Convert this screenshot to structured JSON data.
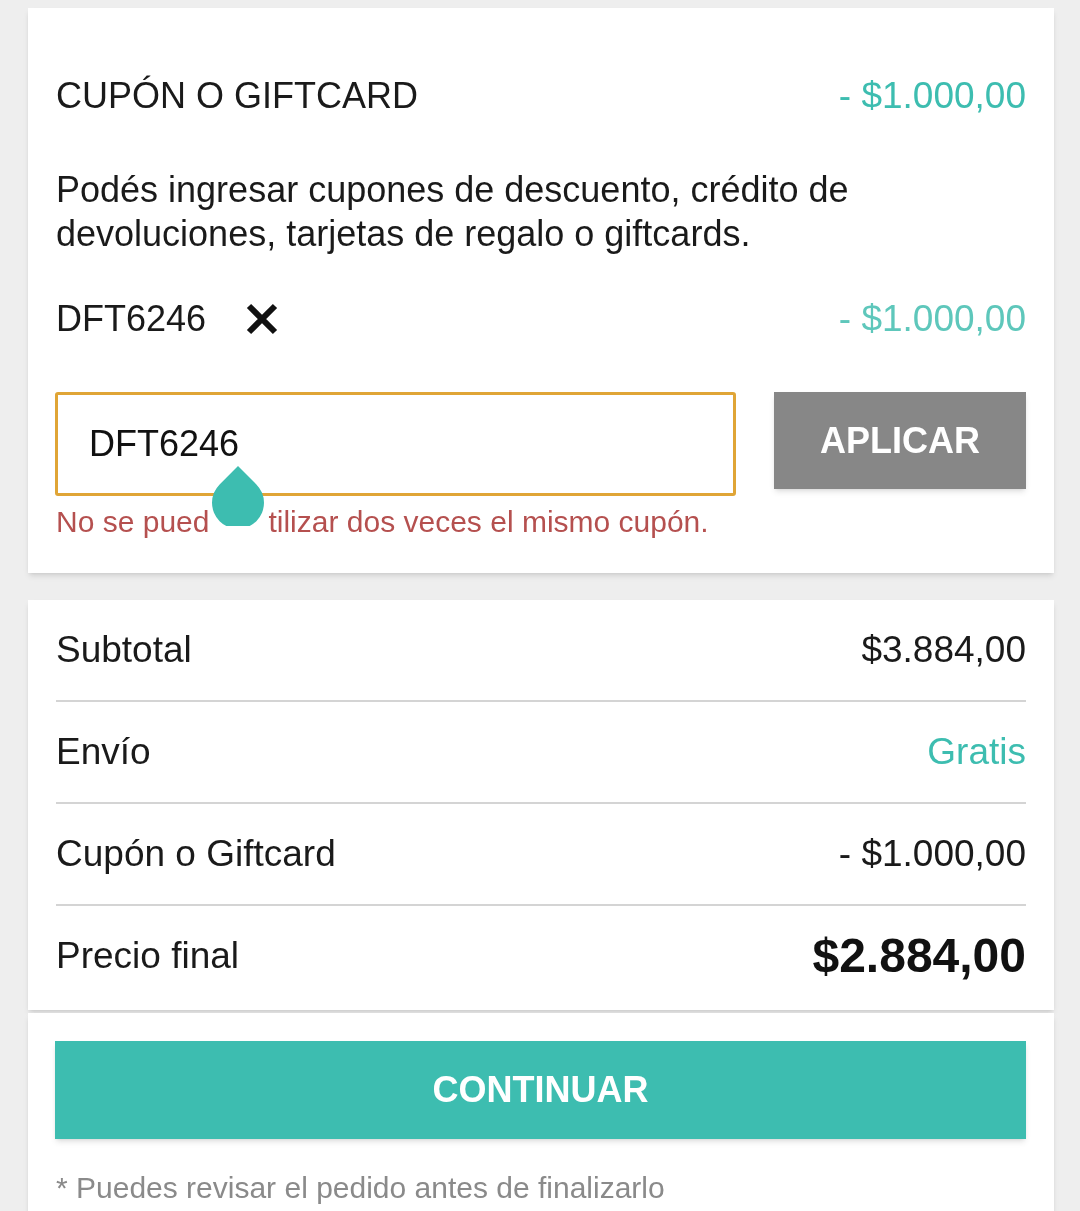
{
  "coupon_card": {
    "title": "CUPÓN O GIFTCARD",
    "total_discount": "- $1.000,00",
    "description": "Podés ingresar cupones de descuento, crédito de devoluciones, tarjetas de regalo o giftcards.",
    "applied_coupons": [
      {
        "code": "DFT6246",
        "amount": "- $1.000,00"
      }
    ],
    "input": {
      "value": "DFT6246",
      "focused": true
    },
    "apply_button": "APLICAR",
    "error_parts": [
      "No se pued",
      "tilizar dos veces el mismo cupón."
    ]
  },
  "summary": {
    "rows": [
      {
        "label": "Subtotal",
        "value": "$3.884,00",
        "kind": "plain"
      },
      {
        "label": "Envío",
        "value": "Gratis",
        "kind": "free"
      },
      {
        "label": "Cupón o Giftcard",
        "value": "- $1.000,00",
        "kind": "plain"
      },
      {
        "label": "Precio final",
        "value": "$2.884,00",
        "kind": "total"
      }
    ]
  },
  "continue_button": "CONTINUAR",
  "note": "* Puedes revisar el pedido antes de finalizarlo"
}
